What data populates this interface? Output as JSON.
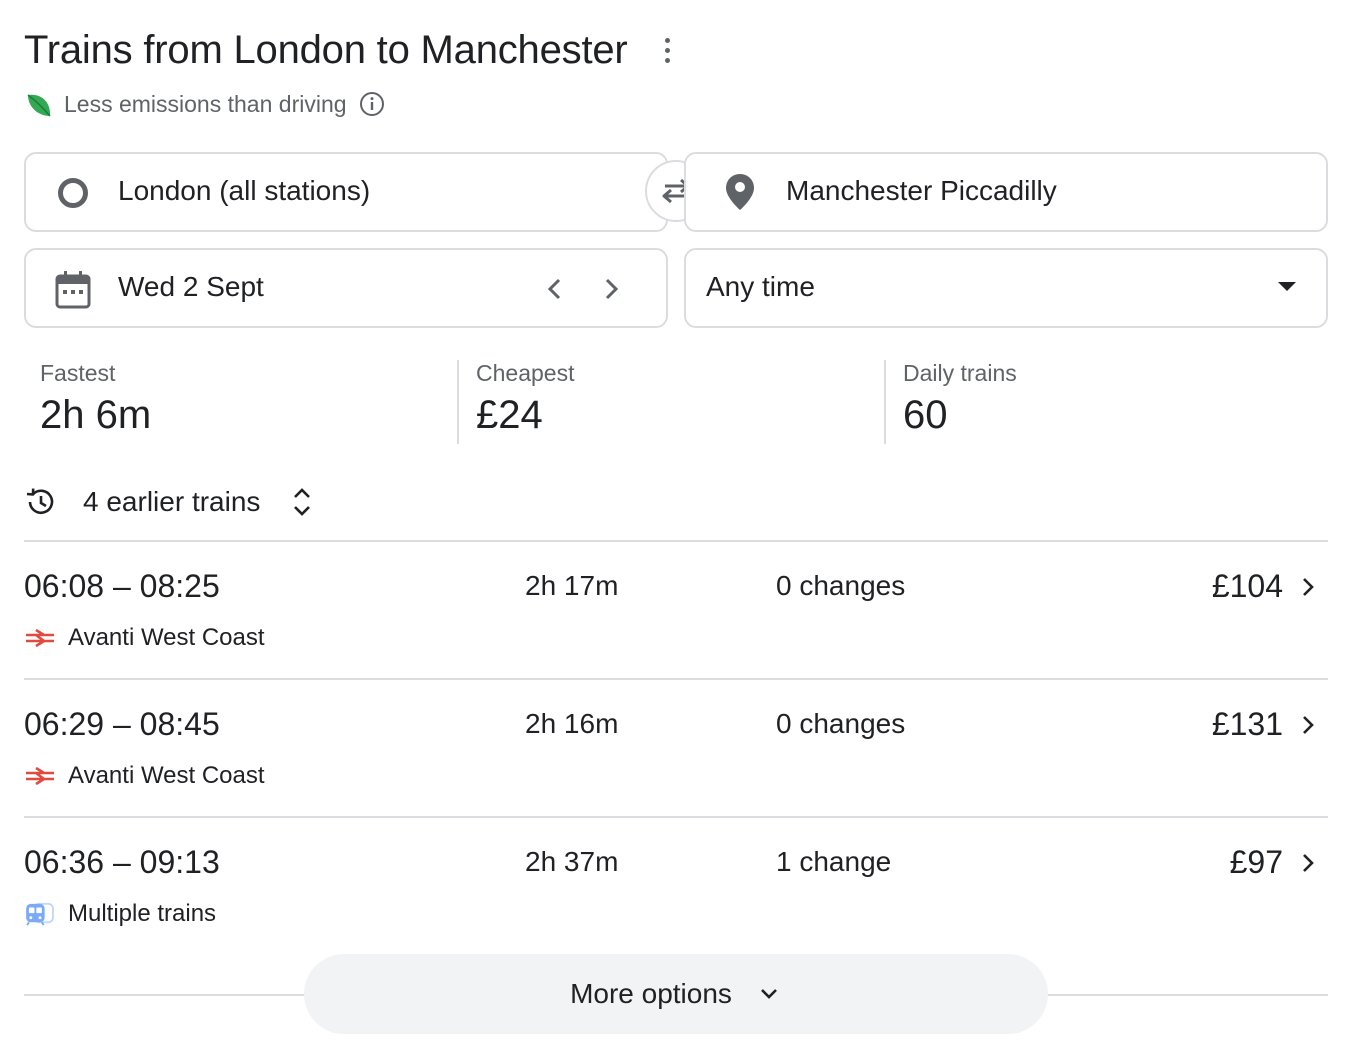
{
  "header": {
    "title": "Trains from London to Manchester",
    "emissions_text": "Less emissions than driving"
  },
  "search": {
    "from": "London (all stations)",
    "to": "Manchester Piccadilly",
    "date": "Wed 2 Sept",
    "time": "Any time"
  },
  "stats": [
    {
      "label": "Fastest",
      "value": "2h 6m"
    },
    {
      "label": "Cheapest",
      "value": "£24"
    },
    {
      "label": "Daily trains",
      "value": "60"
    }
  ],
  "earlier_trains": "4 earlier trains",
  "trips": [
    {
      "times": "06:08 – 08:25",
      "duration": "2h 17m",
      "changes": "0 changes",
      "price": "£104",
      "operator": "Avanti West Coast",
      "operator_icon": "national-rail-icon"
    },
    {
      "times": "06:29 – 08:45",
      "duration": "2h 16m",
      "changes": "0 changes",
      "price": "£131",
      "operator": "Avanti West Coast",
      "operator_icon": "national-rail-icon"
    },
    {
      "times": "06:36 – 09:13",
      "duration": "2h 37m",
      "changes": "1 change",
      "price": "£97",
      "operator": "Multiple trains",
      "operator_icon": "multiple-trains-icon"
    }
  ],
  "more_options": "More options",
  "colors": {
    "text": "#202124",
    "secondary": "#5f6368",
    "border": "#dadce0",
    "rail_red": "#e04a3f",
    "leaf_green": "#1e8e3e",
    "train_blue": "#7baaf7"
  }
}
